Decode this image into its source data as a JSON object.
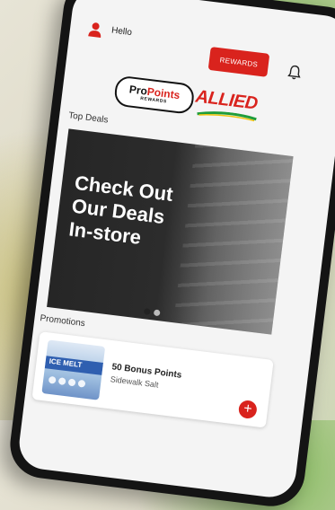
{
  "header": {
    "greeting": "Hello",
    "rewards_label": "REWARDS"
  },
  "logos": {
    "propoints_pro": "Pro",
    "propoints_points": "Points",
    "propoints_sub": "REWARDS",
    "allied": "ALLIED"
  },
  "sections": {
    "top_deals": "Top Deals",
    "promotions": "Promotions"
  },
  "banner": {
    "lines": [
      "Check Out",
      "Our Deals",
      "In-store"
    ]
  },
  "carousel": {
    "count": 2,
    "active_index": 0
  },
  "promotions": [
    {
      "title": "50 Bonus Points",
      "subtitle": "Sidewalk Salt",
      "image_label": "ICE MELT",
      "add_label": "+"
    }
  ],
  "colors": {
    "brand_red": "#d9231d",
    "brand_green": "#1f9d3a",
    "banner_dark": "#262626"
  },
  "icons": {
    "user": "user-icon",
    "notifications": "bell-icon"
  }
}
